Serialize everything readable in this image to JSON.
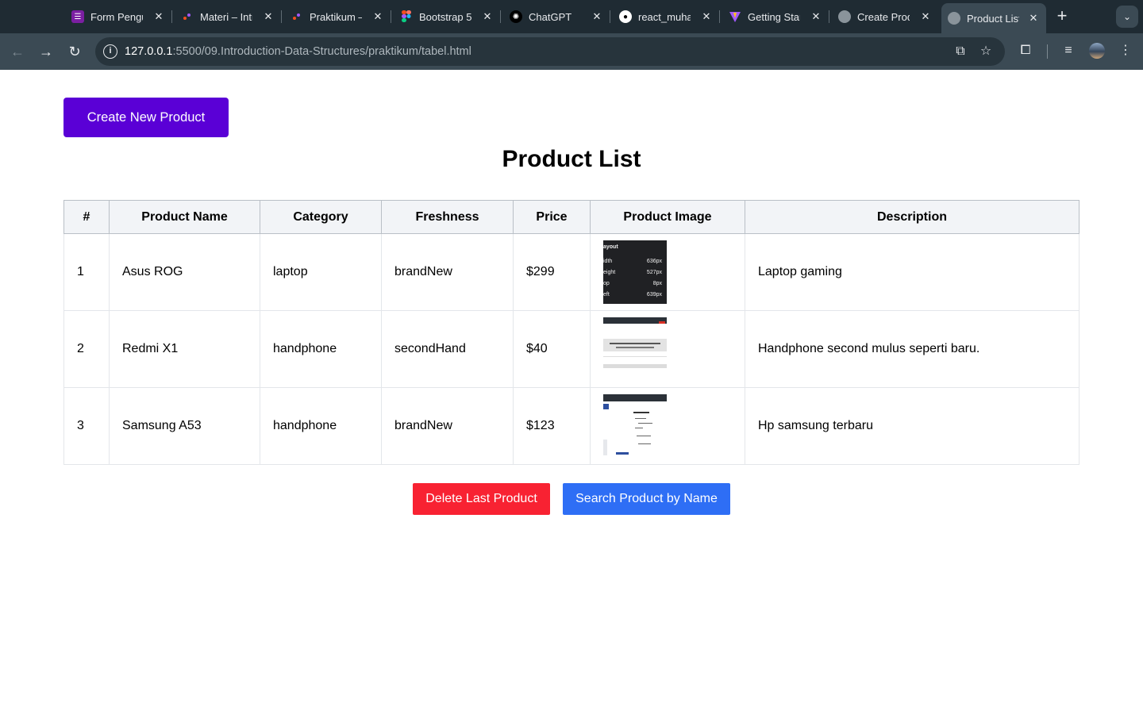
{
  "browser": {
    "tabs": [
      {
        "label": "Form Pengu",
        "icon": "forms-icon",
        "color": "#7b1fa2"
      },
      {
        "label": "Materi – Intr",
        "icon": "figma-slides-icon",
        "color": "#1f2b33"
      },
      {
        "label": "Praktikum –",
        "icon": "figma-slides-icon",
        "color": "#1f2b33"
      },
      {
        "label": "Bootstrap 5",
        "icon": "figma-icon",
        "color": "#1f2b33"
      },
      {
        "label": "ChatGPT",
        "icon": "chatgpt-icon",
        "color": "#1f2b33"
      },
      {
        "label": "react_muha",
        "icon": "github-icon",
        "color": "#1f2b33"
      },
      {
        "label": "Getting Star",
        "icon": "vite-icon",
        "color": "#1f2b33"
      },
      {
        "label": "Create Prod",
        "icon": "globe-icon",
        "color": "#1f2b33"
      },
      {
        "label": "Product List",
        "icon": "globe-icon",
        "color": "#1f2b33"
      }
    ],
    "url_host": "127.0.0.1",
    "url_path": ":5500/09.Introduction-Data-Structures/praktikum/tabel.html"
  },
  "page": {
    "create_button": "Create New Product",
    "title": "Product List",
    "columns": [
      "#",
      "Product Name",
      "Category",
      "Freshness",
      "Price",
      "Product Image",
      "Description"
    ],
    "rows": [
      {
        "no": "1",
        "name": "Asus ROG",
        "category": "laptop",
        "freshness": "brandNew",
        "price": "$299",
        "image_icon": "layout-screenshot-thumbnail",
        "description": "Laptop gaming"
      },
      {
        "no": "2",
        "name": "Redmi X1",
        "category": "handphone",
        "freshness": "secondHand",
        "price": "$40",
        "image_icon": "webpage-screenshot-thumbnail",
        "description": "Handphone second mulus seperti baru."
      },
      {
        "no": "3",
        "name": "Samsung A53",
        "category": "handphone",
        "freshness": "brandNew",
        "price": "$123",
        "image_icon": "webpage-screenshot-thumbnail",
        "description": "Hp samsung terbaru"
      }
    ],
    "thumb1": {
      "heading": "ayout",
      "rows": [
        {
          "k": "idth",
          "v": "636px"
        },
        {
          "k": "eight",
          "v": "527px"
        },
        {
          "k": "op",
          "v": "8px"
        },
        {
          "k": "eft",
          "v": "639px"
        }
      ]
    },
    "delete_button": "Delete Last Product",
    "search_button": "Search Product by Name"
  },
  "colors": {
    "create_button": "#5a00d6",
    "delete_button": "#f82232",
    "search_button": "#2e6ef5"
  }
}
